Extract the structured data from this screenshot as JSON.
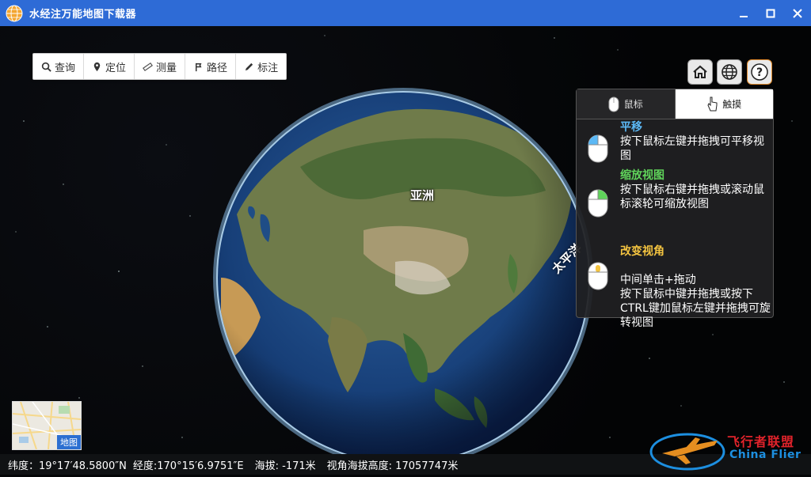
{
  "window": {
    "title": "水经注万能地图下载器"
  },
  "toolbar": {
    "items": [
      {
        "label": "查询",
        "icon": "search-icon"
      },
      {
        "label": "定位",
        "icon": "location-pin-icon"
      },
      {
        "label": "测量",
        "icon": "ruler-icon"
      },
      {
        "label": "路径",
        "icon": "route-icon"
      },
      {
        "label": "标注",
        "icon": "pencil-icon"
      }
    ]
  },
  "map": {
    "label_asia": "亚洲",
    "label_pacific": "太平洋"
  },
  "help_panel": {
    "tab_mouse": "鼠标",
    "tab_touch": "触摸",
    "sections": [
      {
        "title": "平移",
        "title_color": "#5bb8f5",
        "text": "按下鼠标左键并拖拽可平移视图"
      },
      {
        "title": "缩放视图",
        "title_color": "#5fd35a",
        "text": "按下鼠标右键并拖拽或滚动鼠标滚轮可缩放视图"
      },
      {
        "title": "改变视角",
        "title_color": "#f3c340",
        "text": "中间单击+拖动\n按下鼠标中键并拖拽或按下CTRL键加鼠标左键并拖拽可旋转视图"
      }
    ]
  },
  "minimap": {
    "label": "地图"
  },
  "status": {
    "latitude": "纬度：19°17′48.5800″N",
    "longitude": "经度:170°15′6.9751″E",
    "altitude": "海拔: -171米",
    "view_height": "视角海拔高度: 17057747米"
  },
  "watermark": {
    "cn": "飞行者联盟",
    "en": "China Flier"
  },
  "colors": {
    "titlebar": "#2e6bd6",
    "accent_blue": "#2c6fd1"
  }
}
